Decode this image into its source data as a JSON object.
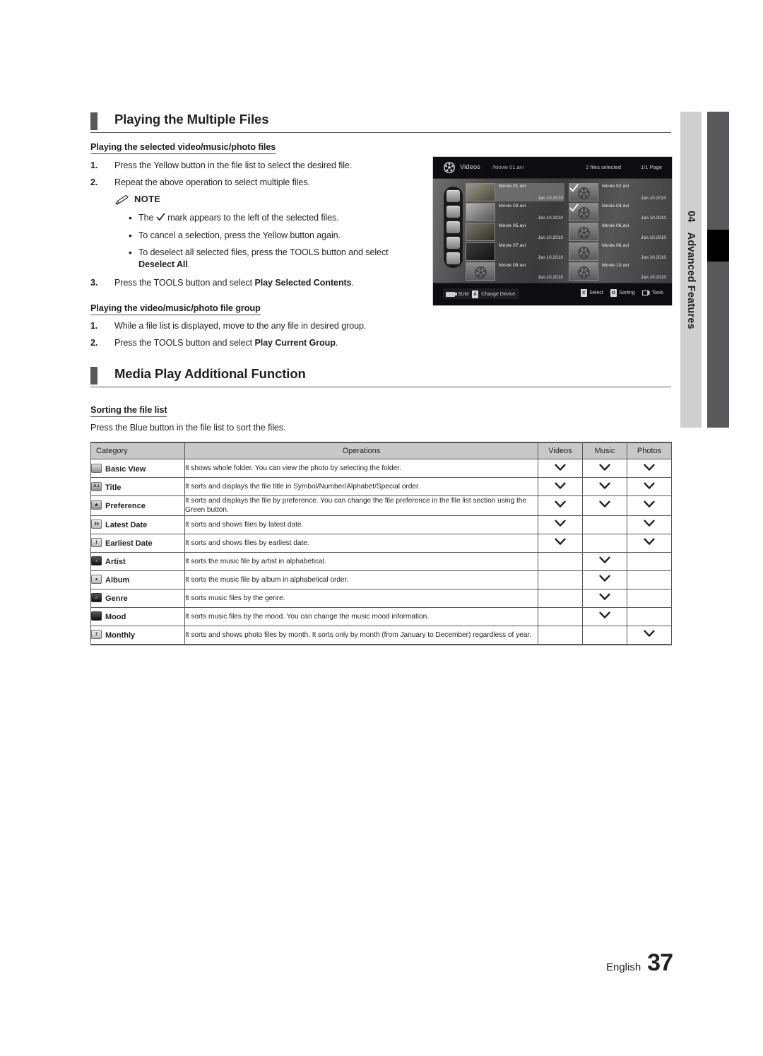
{
  "side_tab": {
    "number": "04",
    "label": "Advanced Features"
  },
  "sections": [
    {
      "id": "playing-multiple-files",
      "title": "Playing the Multiple Files"
    },
    {
      "id": "media-play-additional-function",
      "title": "Media Play Additional Function"
    }
  ],
  "sub_headings": {
    "selected_files": "Playing the selected video/music/photo files",
    "file_group": "Playing the video/music/photo file group",
    "sorting": "Sorting the file list"
  },
  "steps_selected": [
    {
      "n": "1.",
      "text": "Press the Yellow button in the file list to select the desired file."
    },
    {
      "n": "2.",
      "text": "Repeat the above operation to select multiple files."
    },
    {
      "n": "3.",
      "text_pre": "Press the TOOLS button and select ",
      "text_bold": "Play Selected Contents",
      "text_post": "."
    }
  ],
  "note": {
    "label": "NOTE",
    "items": [
      {
        "pre": "The ",
        "icon": "check-mark",
        "post": " mark appears to the left of the selected files."
      },
      {
        "pre": "To cancel a selection, press the Yellow button again.",
        "icon": "",
        "post": ""
      },
      {
        "pre": "To deselect all selected files, press the TOOLS button and select ",
        "bold": "Deselect All",
        "post": "."
      }
    ]
  },
  "steps_group": [
    {
      "n": "1.",
      "text": "While a file list is displayed, move to the any file in desired group."
    },
    {
      "n": "2.",
      "text_pre": "Press the TOOLS button and select ",
      "text_bold": "Play Current Group",
      "text_post": "."
    }
  ],
  "sorting_intro": "Press the Blue button in the file list to sort the files.",
  "tv_screenshot": {
    "mode_label": "Videos",
    "reel_icon": "film-reel-icon",
    "path": "/Movie 01.avi",
    "selected_count": "2 files selected",
    "page": "1/1 Page",
    "sidebar_icons": [
      "folder-icon",
      "title-sort-icon",
      "latest-date-icon",
      "earliest-date-icon",
      "preference-star-icon"
    ],
    "files_left": [
      {
        "name": "Movie 01.avi",
        "date": "Jan.10.2010",
        "thumb": "photo",
        "checked": false,
        "highlighted": true
      },
      {
        "name": "Movie 03.avi",
        "date": "Jan.10.2010",
        "thumb": "photo",
        "checked": false,
        "highlighted": false
      },
      {
        "name": "Movie 05.avi",
        "date": "Jan.10.2010",
        "thumb": "photo",
        "checked": false,
        "highlighted": false
      },
      {
        "name": "Movie 07.avi",
        "date": "Jan.10.2010",
        "thumb": "photo",
        "checked": false,
        "highlighted": false
      },
      {
        "name": "Movie 09.avi",
        "date": "Jan.10.2010",
        "thumb": "reel",
        "checked": false,
        "highlighted": false
      }
    ],
    "files_right": [
      {
        "name": "Movie 02.avi",
        "date": "Jan.10.2010",
        "thumb": "reel",
        "checked": true,
        "highlighted": false
      },
      {
        "name": "Movie 04.avi",
        "date": "Jan.10.2010",
        "thumb": "reel",
        "checked": true,
        "highlighted": false
      },
      {
        "name": "Movie 06.avi",
        "date": "Jan.10.2010",
        "thumb": "reel",
        "checked": false,
        "highlighted": false
      },
      {
        "name": "Movie 08.avi",
        "date": "Jan.10.2010",
        "thumb": "reel",
        "checked": false,
        "highlighted": false
      },
      {
        "name": "Movie 10.avi",
        "date": "Jan.10.2010",
        "thumb": "reel",
        "checked": false,
        "highlighted": false
      }
    ],
    "bottom_left": {
      "usb_icon": "usb-icon",
      "device": "SUM",
      "key": "A",
      "action": "Change Device"
    },
    "bottom_right": [
      {
        "key": "C",
        "action": "Select"
      },
      {
        "key": "D",
        "action": "Sorting"
      },
      {
        "key": "tools-icon",
        "action": "Tools"
      }
    ]
  },
  "table": {
    "headers": [
      "Category",
      "Operations",
      "Videos",
      "Music",
      "Photos"
    ],
    "rows": [
      {
        "icon": "folder-icon",
        "icon_glyph": "",
        "category": "Basic View",
        "operations": "It shows whole folder. You can view the photo by selecting the folder.",
        "videos": true,
        "music": true,
        "photos": true
      },
      {
        "icon": "title-az-icon",
        "icon_glyph": "A z",
        "category": "Title",
        "operations": "It sorts and displays the file title in Symbol/Number/Alphabet/Special order.",
        "videos": true,
        "music": true,
        "photos": true
      },
      {
        "icon": "preference-star-icon",
        "icon_glyph": "★",
        "category": "Preference",
        "operations": "It sorts and displays the file by preference. You can change the file preference in the file list section using the Green button.",
        "videos": true,
        "music": true,
        "photos": true
      },
      {
        "icon": "latest-date-icon",
        "icon_glyph": "30",
        "category": "Latest Date",
        "operations": "It sorts and shows files by latest date.",
        "videos": true,
        "music": false,
        "photos": true
      },
      {
        "icon": "earliest-date-icon",
        "icon_glyph": "1",
        "category": "Earliest Date",
        "operations": "It sorts and shows files by earliest date.",
        "videos": true,
        "music": false,
        "photos": true
      },
      {
        "icon": "artist-icon",
        "icon_glyph": "♪",
        "category": "Artist",
        "operations": "It sorts the music file by artist in alphabetical.",
        "videos": false,
        "music": true,
        "photos": false
      },
      {
        "icon": "album-icon",
        "icon_glyph": "●",
        "category": "Album",
        "operations": "It sorts the music file by album in alphabetical order.",
        "videos": false,
        "music": true,
        "photos": false
      },
      {
        "icon": "genre-icon",
        "icon_glyph": "♫",
        "category": "Genre",
        "operations": "It sorts music files by the genre.",
        "videos": false,
        "music": true,
        "photos": false
      },
      {
        "icon": "mood-icon",
        "icon_glyph": "",
        "category": "Mood",
        "operations": "It sorts music files by the mood. You can change the music mood information.",
        "videos": false,
        "music": true,
        "photos": false
      },
      {
        "icon": "monthly-icon",
        "icon_glyph": "7",
        "category": "Monthly",
        "operations": "It sorts and shows photo files by month. It sorts only by month (from January to December) regardless of year.",
        "videos": false,
        "music": false,
        "photos": true
      }
    ]
  },
  "footer": {
    "language": "English",
    "page_number": "37"
  }
}
